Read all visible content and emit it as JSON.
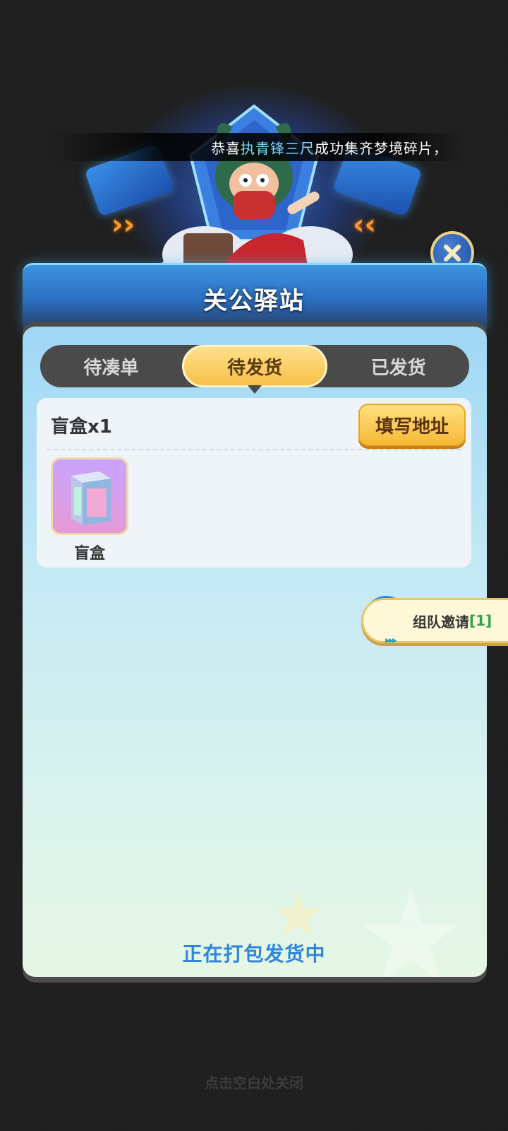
{
  "notice": {
    "prefix": "恭喜",
    "highlight": "执青锋三尺",
    "suffix": " 成功集齐梦境碎片，"
  },
  "panel": {
    "title": "关公驿站"
  },
  "tabs": [
    {
      "label": "待凑单",
      "active": false
    },
    {
      "label": "待发货",
      "active": true
    },
    {
      "label": "已发货",
      "active": false
    }
  ],
  "order": {
    "title": "盲盒x1",
    "address_button": "填写地址",
    "items": [
      {
        "label": "盲盒",
        "icon": "blind-box-icon"
      }
    ]
  },
  "status_text": "正在打包发货中",
  "invite": {
    "label": "组队邀请",
    "count": "[1]",
    "icon": "megaphone-icon"
  },
  "close_hint": "点击空白处关闭",
  "colors": {
    "tab_active": "#f7c04a",
    "status_text": "#2f86d9",
    "invite_count": "#2aa34a",
    "notice_highlight": "#7fd7ff"
  }
}
